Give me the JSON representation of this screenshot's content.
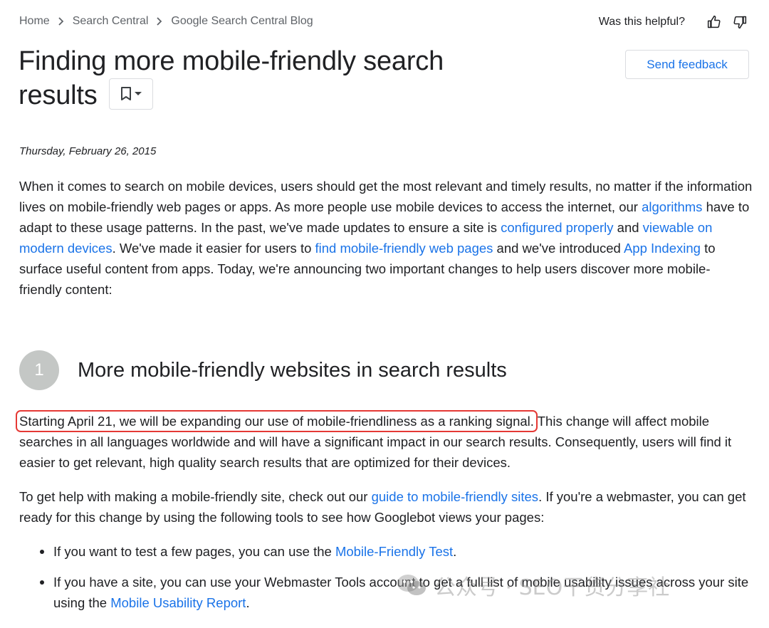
{
  "breadcrumb": {
    "items": [
      "Home",
      "Search Central",
      "Google Search Central Blog"
    ]
  },
  "helpful": {
    "label": "Was this helpful?"
  },
  "header": {
    "title_line1": "Finding more mobile-friendly search",
    "title_line2": "results",
    "feedback_label": "Send feedback"
  },
  "post": {
    "date": "Thursday, February 26, 2015",
    "intro": {
      "t1": "When it comes to search on mobile devices, users should get the most relevant and timely results, no matter if the information lives on mobile-friendly web pages or apps. As more people use mobile devices to access the internet, our ",
      "link1": "algorithms",
      "t2": " have to adapt to these usage patterns. In the past, we've made updates to ensure a site is ",
      "link2": "configured properly",
      "t3": " and ",
      "link3": "viewable on modern devices",
      "t4": ". We've made it easier for users to ",
      "link4": "find mobile-friendly web pages",
      "t5": " and we've introduced ",
      "link5": "App Indexing",
      "t6": " to surface useful content from apps. Today, we're announcing two important changes to help users discover more mobile-friendly content:"
    },
    "section1": {
      "number": "1",
      "heading": "More mobile-friendly websites in search results",
      "highlight": "Starting April 21, we will be expanding our use of mobile-friendliness as a ranking signal.",
      "rest": " This change will affect mobile searches in all languages worldwide and will have a significant impact in our search results. Consequently, users will find it easier to get relevant, high quality search results that are optimized for their devices."
    },
    "help": {
      "t1": "To get help with making a mobile-friendly site, check out our ",
      "link": "guide to mobile-friendly sites",
      "t2": ". If you're a webmaster, you can get ready for this change by using the following tools to see how Googlebot views your pages:"
    },
    "tools": [
      {
        "text": "If you want to test a few pages, you can use the ",
        "link": "Mobile-Friendly Test",
        "end": "."
      },
      {
        "text": "If you have a site, you can use your Webmaster Tools account to get a full list of mobile usability issues across your site using the ",
        "link": "Mobile Usability Report",
        "end": "."
      }
    ]
  },
  "watermark": {
    "text": "公众号 · SEO干货分享社"
  },
  "colors": {
    "link": "#1a73e8",
    "highlight_border": "#e53935",
    "step_circle": "#c4c7c5"
  },
  "icons": [
    "chevron-right-icon",
    "thumb-up-icon",
    "thumb-down-icon",
    "bookmark-icon",
    "caret-down-icon",
    "wechat-icon"
  ]
}
